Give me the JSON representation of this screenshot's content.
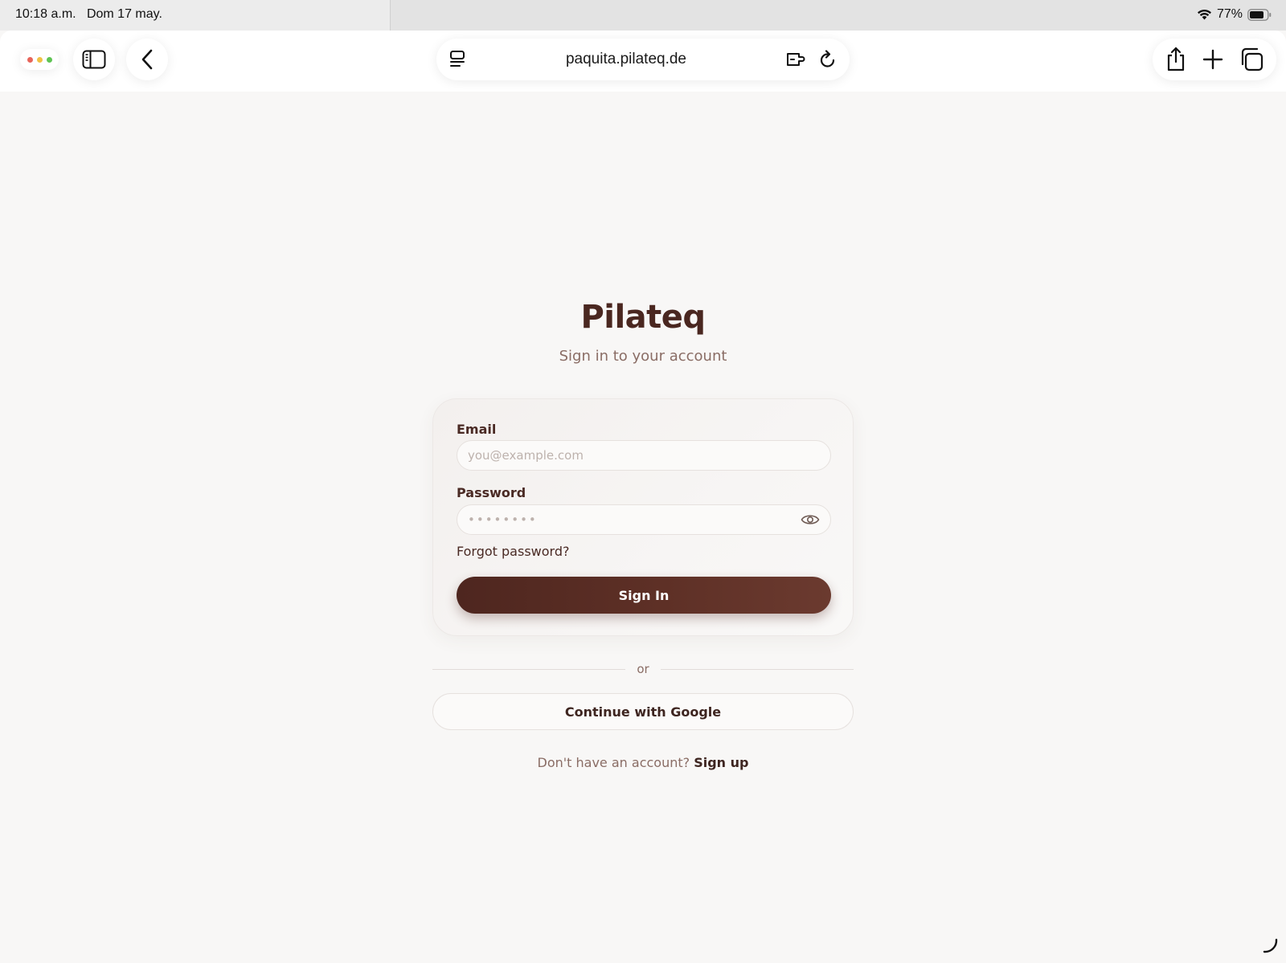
{
  "status_bar": {
    "time": "10:18 a.m.",
    "date": "Dom 17 may.",
    "battery": "77%",
    "wifi_icon": "wifi-icon",
    "battery_icon": "battery-icon"
  },
  "browser": {
    "url": "paquita.pilateq.de",
    "icons": {
      "window_dots": "window-dots-icon",
      "sidebar": "sidebar-icon",
      "back": "chevron-left-icon",
      "reader": "reader-icon",
      "extension": "extension-icon",
      "reload": "reload-icon",
      "share": "share-icon",
      "new_tab": "plus-icon",
      "tabs": "tabs-icon"
    }
  },
  "page": {
    "title": "Pilateq",
    "subtitle": "Sign in to your account",
    "email": {
      "label": "Email",
      "placeholder": "you@example.com",
      "value": ""
    },
    "password": {
      "label": "Password",
      "placeholder": "••••••••",
      "value": ""
    },
    "forgot_password": "Forgot password?",
    "sign_in": "Sign In",
    "divider": "or",
    "google": "Continue with Google",
    "signup_prompt": "Don't have an account?",
    "signup_link": "Sign up"
  },
  "colors": {
    "background": "#f8f7f6",
    "brand_dark": "#4a2720",
    "button_brown": "#5e3026",
    "muted_text": "#8a6d65"
  }
}
